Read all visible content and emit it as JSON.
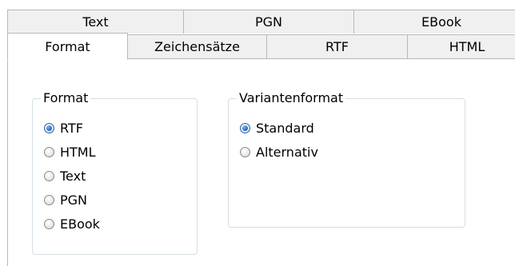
{
  "tabs_back": [
    {
      "label": "Text"
    },
    {
      "label": "PGN"
    },
    {
      "label": "EBook"
    }
  ],
  "tabs_front": [
    {
      "label": "Format",
      "active": true
    },
    {
      "label": "Zeichensätze"
    },
    {
      "label": "RTF"
    },
    {
      "label": "HTML"
    }
  ],
  "format_group": {
    "title": "Format",
    "options": [
      {
        "label": "RTF",
        "checked": true
      },
      {
        "label": "HTML",
        "checked": false
      },
      {
        "label": "Text",
        "checked": false
      },
      {
        "label": "PGN",
        "checked": false
      },
      {
        "label": "EBook",
        "checked": false
      }
    ]
  },
  "variant_group": {
    "title": "Variantenformat",
    "options": [
      {
        "label": "Standard",
        "checked": true
      },
      {
        "label": "Alternativ",
        "checked": false
      }
    ]
  }
}
